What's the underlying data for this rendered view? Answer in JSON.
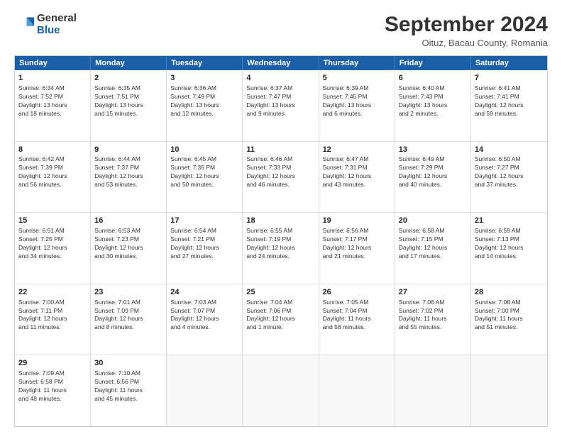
{
  "header": {
    "logo_general": "General",
    "logo_blue": "Blue",
    "month_year": "September 2024",
    "location": "Oituz, Bacau County, Romania"
  },
  "weekdays": [
    "Sunday",
    "Monday",
    "Tuesday",
    "Wednesday",
    "Thursday",
    "Friday",
    "Saturday"
  ],
  "rows": [
    [
      {
        "day": "1",
        "info": "Sunrise: 6:34 AM\nSunset: 7:52 PM\nDaylight: 13 hours\nand 18 minutes."
      },
      {
        "day": "2",
        "info": "Sunrise: 6:35 AM\nSunset: 7:51 PM\nDaylight: 13 hours\nand 15 minutes."
      },
      {
        "day": "3",
        "info": "Sunrise: 6:36 AM\nSunset: 7:49 PM\nDaylight: 13 hours\nand 12 minutes."
      },
      {
        "day": "4",
        "info": "Sunrise: 6:37 AM\nSunset: 7:47 PM\nDaylight: 13 hours\nand 9 minutes."
      },
      {
        "day": "5",
        "info": "Sunrise: 6:39 AM\nSunset: 7:45 PM\nDaylight: 13 hours\nand 6 minutes."
      },
      {
        "day": "6",
        "info": "Sunrise: 6:40 AM\nSunset: 7:43 PM\nDaylight: 13 hours\nand 2 minutes."
      },
      {
        "day": "7",
        "info": "Sunrise: 6:41 AM\nSunset: 7:41 PM\nDaylight: 12 hours\nand 59 minutes."
      }
    ],
    [
      {
        "day": "8",
        "info": "Sunrise: 6:42 AM\nSunset: 7:39 PM\nDaylight: 12 hours\nand 56 minutes."
      },
      {
        "day": "9",
        "info": "Sunrise: 6:44 AM\nSunset: 7:37 PM\nDaylight: 12 hours\nand 53 minutes."
      },
      {
        "day": "10",
        "info": "Sunrise: 6:45 AM\nSunset: 7:35 PM\nDaylight: 12 hours\nand 50 minutes."
      },
      {
        "day": "11",
        "info": "Sunrise: 6:46 AM\nSunset: 7:33 PM\nDaylight: 12 hours\nand 46 minutes."
      },
      {
        "day": "12",
        "info": "Sunrise: 6:47 AM\nSunset: 7:31 PM\nDaylight: 12 hours\nand 43 minutes."
      },
      {
        "day": "13",
        "info": "Sunrise: 6:49 AM\nSunset: 7:29 PM\nDaylight: 12 hours\nand 40 minutes."
      },
      {
        "day": "14",
        "info": "Sunrise: 6:50 AM\nSunset: 7:27 PM\nDaylight: 12 hours\nand 37 minutes."
      }
    ],
    [
      {
        "day": "15",
        "info": "Sunrise: 6:51 AM\nSunset: 7:25 PM\nDaylight: 12 hours\nand 34 minutes."
      },
      {
        "day": "16",
        "info": "Sunrise: 6:53 AM\nSunset: 7:23 PM\nDaylight: 12 hours\nand 30 minutes."
      },
      {
        "day": "17",
        "info": "Sunrise: 6:54 AM\nSunset: 7:21 PM\nDaylight: 12 hours\nand 27 minutes."
      },
      {
        "day": "18",
        "info": "Sunrise: 6:55 AM\nSunset: 7:19 PM\nDaylight: 12 hours\nand 24 minutes."
      },
      {
        "day": "19",
        "info": "Sunrise: 6:56 AM\nSunset: 7:17 PM\nDaylight: 12 hours\nand 21 minutes."
      },
      {
        "day": "20",
        "info": "Sunrise: 6:58 AM\nSunset: 7:15 PM\nDaylight: 12 hours\nand 17 minutes."
      },
      {
        "day": "21",
        "info": "Sunrise: 6:59 AM\nSunset: 7:13 PM\nDaylight: 12 hours\nand 14 minutes."
      }
    ],
    [
      {
        "day": "22",
        "info": "Sunrise: 7:00 AM\nSunset: 7:11 PM\nDaylight: 12 hours\nand 11 minutes."
      },
      {
        "day": "23",
        "info": "Sunrise: 7:01 AM\nSunset: 7:09 PM\nDaylight: 12 hours\nand 8 minutes."
      },
      {
        "day": "24",
        "info": "Sunrise: 7:03 AM\nSunset: 7:07 PM\nDaylight: 12 hours\nand 4 minutes."
      },
      {
        "day": "25",
        "info": "Sunrise: 7:04 AM\nSunset: 7:06 PM\nDaylight: 12 hours\nand 1 minute."
      },
      {
        "day": "26",
        "info": "Sunrise: 7:05 AM\nSunset: 7:04 PM\nDaylight: 11 hours\nand 58 minutes."
      },
      {
        "day": "27",
        "info": "Sunrise: 7:06 AM\nSunset: 7:02 PM\nDaylight: 11 hours\nand 55 minutes."
      },
      {
        "day": "28",
        "info": "Sunrise: 7:08 AM\nSunset: 7:00 PM\nDaylight: 11 hours\nand 51 minutes."
      }
    ],
    [
      {
        "day": "29",
        "info": "Sunrise: 7:09 AM\nSunset: 6:58 PM\nDaylight: 11 hours\nand 48 minutes."
      },
      {
        "day": "30",
        "info": "Sunrise: 7:10 AM\nSunset: 6:56 PM\nDaylight: 11 hours\nand 45 minutes."
      },
      {
        "day": "",
        "info": ""
      },
      {
        "day": "",
        "info": ""
      },
      {
        "day": "",
        "info": ""
      },
      {
        "day": "",
        "info": ""
      },
      {
        "day": "",
        "info": ""
      }
    ]
  ]
}
